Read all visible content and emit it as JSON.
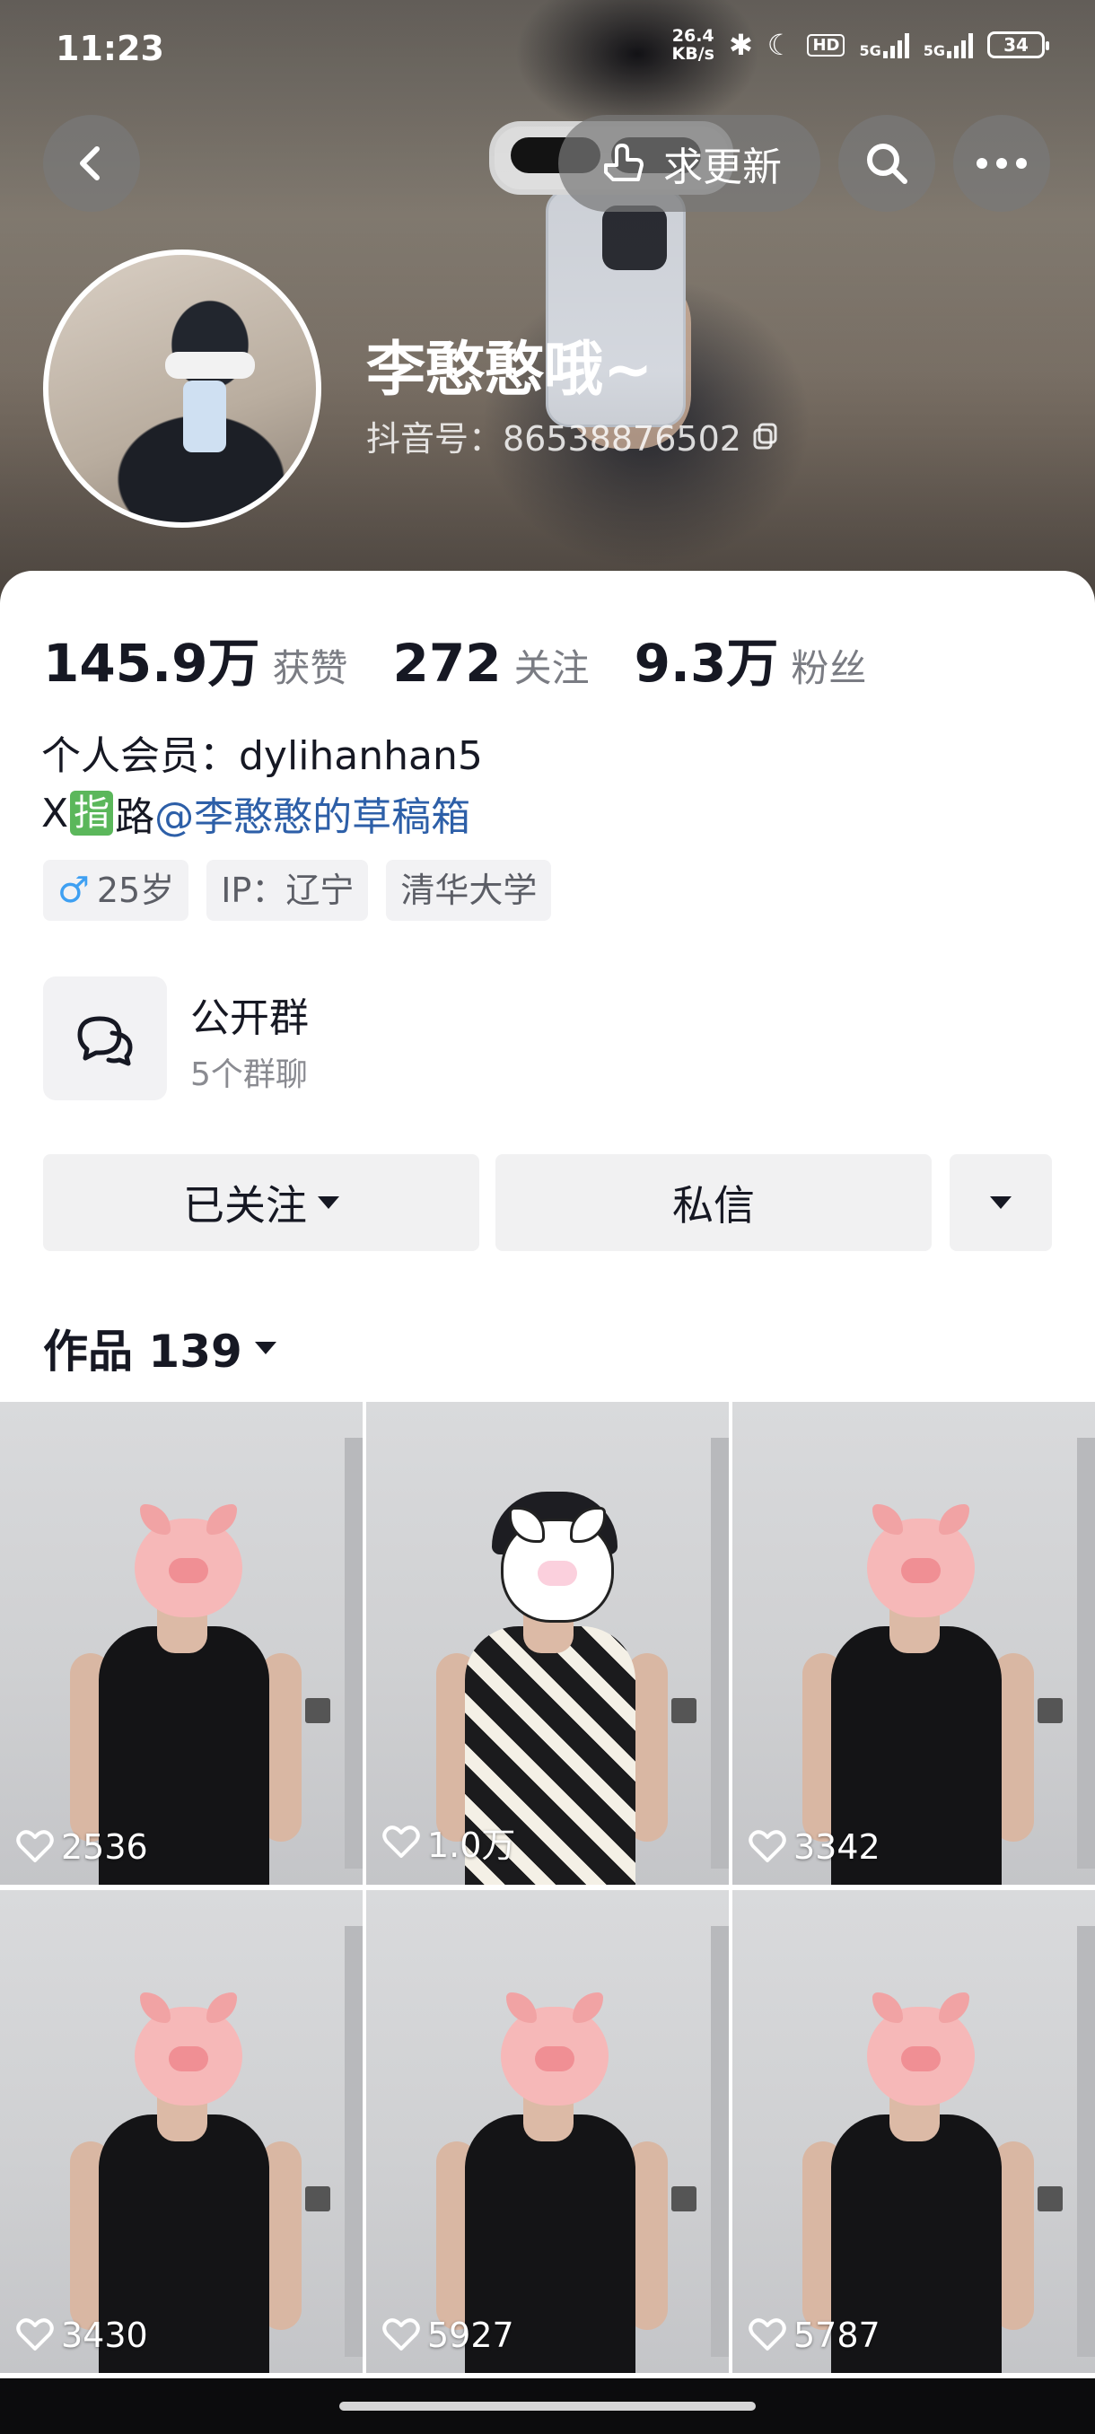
{
  "status_bar": {
    "time": "11:23",
    "net_speed_top": "26.4",
    "net_speed_bottom": "KB/s",
    "hd": "HD",
    "sim1": "5G",
    "sim2": "5G",
    "battery": "34"
  },
  "header": {
    "request_update_label": "求更新",
    "username": "李憨憨哦~",
    "douyin_id": "抖音号：86538876502"
  },
  "stats": [
    {
      "value": "145.9万",
      "label": "获赞"
    },
    {
      "value": "272",
      "label": "关注"
    },
    {
      "value": "9.3万",
      "label": "粉丝"
    }
  ],
  "bio": {
    "line1": "个人会员：dylihanhan5",
    "line2_prefix": "X",
    "line2_badge": "指",
    "line2_mid": "路",
    "line2_link": "@李憨憨的草稿箱"
  },
  "tags": {
    "gender_symbol": "♂",
    "age": "25岁",
    "ip": "IP：辽宁",
    "school": "清华大学"
  },
  "group": {
    "title": "公开群",
    "subtitle": "5个群聊"
  },
  "actions": {
    "follow_label": "已关注",
    "message_label": "私信"
  },
  "works_tab": {
    "label": "作品 139"
  },
  "videos": [
    {
      "likes": "2536"
    },
    {
      "likes": "1.0万"
    },
    {
      "likes": "3342"
    },
    {
      "likes": "3430"
    },
    {
      "likes": "5927"
    },
    {
      "likes": "5787"
    }
  ]
}
